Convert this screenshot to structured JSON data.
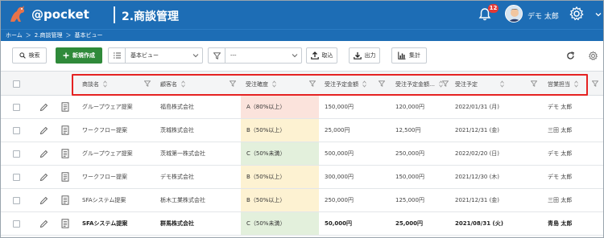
{
  "header": {
    "logo_text": "@pocket",
    "logo_sub": "",
    "page_title": "2.商談管理",
    "notification_count": "12",
    "user_name": "デモ 太郎",
    "brand_color": "#1d6db5"
  },
  "breadcrumb": [
    "ホーム",
    "＞",
    "2.商談管理",
    "＞",
    "基本ビュー"
  ],
  "toolbar": {
    "search_label": "検索",
    "new_label": "新規作成",
    "view_select": "基本ビュー",
    "filter_select": "---",
    "import_label": "取込",
    "export_label": "出力",
    "aggregate_label": "集計"
  },
  "columns": [
    "商談名",
    "顧客名",
    "受注確度",
    "受注予定金額",
    "受注予定金額…",
    "受注予定",
    "営業担当"
  ],
  "rows": [
    {
      "name": "グループウェア提案",
      "customer": "福島株式会社",
      "probability": "A（80%以上）",
      "prob_color": "#fbe3dc",
      "amount1": "150,000円",
      "amount2": "120,000円",
      "date": "2022/01/31 (月)",
      "owner": "デモ 太郎"
    },
    {
      "name": "ワークフロー提案",
      "customer": "茨城株式会社",
      "probability": "B（50%以上）",
      "prob_color": "#fdf2d2",
      "amount1": "25,000円",
      "amount2": "12,500円",
      "date": "2021/12/31 (金)",
      "owner": "三田 太郎"
    },
    {
      "name": "グループウェア提案",
      "customer": "茨城第一株式会社",
      "probability": "C（50%未満）",
      "prob_color": "#e3f0dc",
      "amount1": "500,000円",
      "amount2": "250,000円",
      "date": "2022/02/20 (日)",
      "owner": "デモ 太郎"
    },
    {
      "name": "ワークフロー提案",
      "customer": "デモ株式会社",
      "probability": "B（50%以上）",
      "prob_color": "#fdf2d2",
      "amount1": "300,000円",
      "amount2": "150,000円",
      "date": "2021/12/30 (木)",
      "owner": "デモ 太郎"
    },
    {
      "name": "SFAシステム提案",
      "customer": "栃木工業株式会社",
      "probability": "B（50%以上）",
      "prob_color": "#fdf2d2",
      "amount1": "250,000円",
      "amount2": "125,000円",
      "date": "2021/12/31 (金)",
      "owner": "三田 太郎"
    },
    {
      "name": "SFAシステム提案",
      "customer": "群馬株式会社",
      "probability": "C（50%未満）",
      "prob_color": "#e3f0dc",
      "amount1": "50,000円",
      "amount2": "25,000円",
      "date": "2021/08/31 (火)",
      "owner": "青島 太郎"
    }
  ]
}
